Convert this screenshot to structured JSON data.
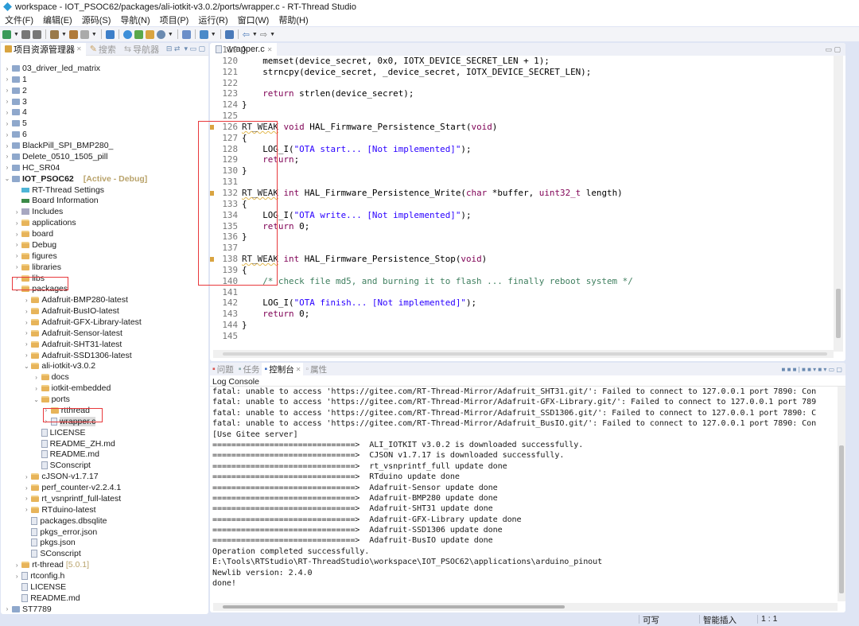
{
  "window": {
    "title": "workspace - IOT_PSOC62/packages/ali-iotkit-v3.0.2/ports/wrapper.c - RT-Thread Studio"
  },
  "menu": [
    "文件(F)",
    "编辑(E)",
    "源码(S)",
    "导航(N)",
    "项目(P)",
    "运行(R)",
    "窗口(W)",
    "帮助(H)"
  ],
  "left_panel": {
    "tabs": [
      "项目资源管理器",
      "搜索",
      "导航器"
    ],
    "tree": [
      {
        "level": 0,
        "arrow": ">",
        "icon": "project",
        "label": "03_driver_led_matrix"
      },
      {
        "level": 0,
        "arrow": ">",
        "icon": "project",
        "label": "1"
      },
      {
        "level": 0,
        "arrow": ">",
        "icon": "project",
        "label": "2"
      },
      {
        "level": 0,
        "arrow": ">",
        "icon": "project",
        "label": "3"
      },
      {
        "level": 0,
        "arrow": ">",
        "icon": "project",
        "label": "4"
      },
      {
        "level": 0,
        "arrow": ">",
        "icon": "project",
        "label": "5"
      },
      {
        "level": 0,
        "arrow": ">",
        "icon": "project",
        "label": "6"
      },
      {
        "level": 0,
        "arrow": ">",
        "icon": "project",
        "label": "BlackPill_SPI_BMP280_"
      },
      {
        "level": 0,
        "arrow": ">",
        "icon": "project",
        "label": "Delete_0510_1505_pill"
      },
      {
        "level": 0,
        "arrow": ">",
        "icon": "project",
        "label": "HC_SR04"
      },
      {
        "level": 0,
        "arrow": "v",
        "icon": "project",
        "label": "IOT_PSOC62",
        "decor": "[Active - Debug]",
        "bold": true
      },
      {
        "level": 1,
        "arrow": "",
        "icon": "rt-settings",
        "label": "RT-Thread Settings"
      },
      {
        "level": 1,
        "arrow": "",
        "icon": "board",
        "label": "Board Information"
      },
      {
        "level": 1,
        "arrow": ">",
        "icon": "includes",
        "label": "Includes"
      },
      {
        "level": 1,
        "arrow": ">",
        "icon": "folder",
        "label": "applications"
      },
      {
        "level": 1,
        "arrow": ">",
        "icon": "folder",
        "label": "board"
      },
      {
        "level": 1,
        "arrow": ">",
        "icon": "folder",
        "label": "Debug"
      },
      {
        "level": 1,
        "arrow": ">",
        "icon": "folder",
        "label": "figures"
      },
      {
        "level": 1,
        "arrow": ">",
        "icon": "folder",
        "label": "libraries"
      },
      {
        "level": 1,
        "arrow": ">",
        "icon": "folder",
        "label": "libs"
      },
      {
        "level": 1,
        "arrow": "v",
        "icon": "folder",
        "label": "packages",
        "highlighted": true
      },
      {
        "level": 2,
        "arrow": ">",
        "icon": "folder",
        "label": "Adafruit-BMP280-latest"
      },
      {
        "level": 2,
        "arrow": ">",
        "icon": "folder",
        "label": "Adafruit-BusIO-latest"
      },
      {
        "level": 2,
        "arrow": ">",
        "icon": "folder",
        "label": "Adafruit-GFX-Library-latest"
      },
      {
        "level": 2,
        "arrow": ">",
        "icon": "folder",
        "label": "Adafruit-Sensor-latest"
      },
      {
        "level": 2,
        "arrow": ">",
        "icon": "folder",
        "label": "Adafruit-SHT31-latest"
      },
      {
        "level": 2,
        "arrow": ">",
        "icon": "folder",
        "label": "Adafruit-SSD1306-latest"
      },
      {
        "level": 2,
        "arrow": "v",
        "icon": "folder",
        "label": "ali-iotkit-v3.0.2"
      },
      {
        "level": 3,
        "arrow": ">",
        "icon": "folder",
        "label": "docs"
      },
      {
        "level": 3,
        "arrow": ">",
        "icon": "folder",
        "label": "iotkit-embedded"
      },
      {
        "level": 3,
        "arrow": "v",
        "icon": "folder",
        "label": "ports"
      },
      {
        "level": 4,
        "arrow": ">",
        "icon": "folder",
        "label": "rtthread"
      },
      {
        "level": 4,
        "arrow": ">",
        "icon": "file",
        "label": "wrapper.c",
        "selected": true,
        "highlighted": true
      },
      {
        "level": 3,
        "arrow": "",
        "icon": "file",
        "label": "LICENSE"
      },
      {
        "level": 3,
        "arrow": "",
        "icon": "file",
        "label": "README_ZH.md"
      },
      {
        "level": 3,
        "arrow": "",
        "icon": "file",
        "label": "README.md"
      },
      {
        "level": 3,
        "arrow": "",
        "icon": "file",
        "label": "SConscript"
      },
      {
        "level": 2,
        "arrow": ">",
        "icon": "folder",
        "label": "cJSON-v1.7.17"
      },
      {
        "level": 2,
        "arrow": ">",
        "icon": "folder",
        "label": "perf_counter-v2.2.4.1"
      },
      {
        "level": 2,
        "arrow": ">",
        "icon": "folder",
        "label": "rt_vsnprintf_full-latest"
      },
      {
        "level": 2,
        "arrow": ">",
        "icon": "folder",
        "label": "RTduino-latest"
      },
      {
        "level": 2,
        "arrow": "",
        "icon": "file",
        "label": "packages.dbsqlite"
      },
      {
        "level": 2,
        "arrow": "",
        "icon": "file",
        "label": "pkgs_error.json"
      },
      {
        "level": 2,
        "arrow": "",
        "icon": "file",
        "label": "pkgs.json"
      },
      {
        "level": 2,
        "arrow": "",
        "icon": "file",
        "label": "SConscript"
      },
      {
        "level": 1,
        "arrow": ">",
        "icon": "folder",
        "label": "rt-thread",
        "decor2": "[5.0.1]"
      },
      {
        "level": 1,
        "arrow": ">",
        "icon": "file",
        "label": "rtconfig.h"
      },
      {
        "level": 1,
        "arrow": "",
        "icon": "file",
        "label": "LICENSE"
      },
      {
        "level": 1,
        "arrow": "",
        "icon": "file",
        "label": "README.md"
      },
      {
        "level": 0,
        "arrow": ">",
        "icon": "project",
        "label": "ST7789"
      }
    ]
  },
  "editor": {
    "tab": "wrapper.c",
    "lines": [
      {
        "n": "119",
        "t": [
          [
            "pl",
            "}"
          ]
        ]
      },
      {
        "n": "120",
        "t": [
          [
            "pl",
            "    memset(device_secret, 0x0, IOTX_DEVICE_SECRET_LEN + 1);"
          ]
        ]
      },
      {
        "n": "121",
        "t": [
          [
            "pl",
            "    strncpy(device_secret, _device_secret, IOTX_DEVICE_SECRET_LEN);"
          ]
        ]
      },
      {
        "n": "122",
        "t": []
      },
      {
        "n": "123",
        "t": [
          [
            "pl",
            "    "
          ],
          [
            "kw",
            "return"
          ],
          [
            "pl",
            " strlen(device_secret);"
          ]
        ]
      },
      {
        "n": "124",
        "t": [
          [
            "pl",
            "}"
          ]
        ]
      },
      {
        "n": "125",
        "t": []
      },
      {
        "n": "126",
        "m": true,
        "t": [
          [
            "warn",
            "RT_WEAK"
          ],
          [
            "pl",
            " "
          ],
          [
            "kw",
            "void"
          ],
          [
            "pl",
            " HAL_Firmware_Persistence_Start("
          ],
          [
            "kw",
            "void"
          ],
          [
            "pl",
            ")"
          ]
        ]
      },
      {
        "n": "127",
        "t": [
          [
            "pl",
            "{"
          ]
        ]
      },
      {
        "n": "128",
        "t": [
          [
            "pl",
            "    LOG_I("
          ],
          [
            "st",
            "\"OTA start... [Not implemented]\""
          ],
          [
            "pl",
            ");"
          ]
        ]
      },
      {
        "n": "129",
        "t": [
          [
            "pl",
            "    "
          ],
          [
            "kw",
            "return"
          ],
          [
            "pl",
            ";"
          ]
        ]
      },
      {
        "n": "130",
        "t": [
          [
            "pl",
            "}"
          ]
        ]
      },
      {
        "n": "131",
        "t": []
      },
      {
        "n": "132",
        "m": true,
        "t": [
          [
            "warn",
            "RT_WEAK"
          ],
          [
            "pl",
            " "
          ],
          [
            "kw",
            "int"
          ],
          [
            "pl",
            " HAL_Firmware_Persistence_Write("
          ],
          [
            "kw",
            "char"
          ],
          [
            "pl",
            " *buffer, "
          ],
          [
            "kw",
            "uint32_t"
          ],
          [
            "pl",
            " length)"
          ]
        ]
      },
      {
        "n": "133",
        "t": [
          [
            "pl",
            "{"
          ]
        ]
      },
      {
        "n": "134",
        "t": [
          [
            "pl",
            "    LOG_I("
          ],
          [
            "st",
            "\"OTA write... [Not implemented]\""
          ],
          [
            "pl",
            ");"
          ]
        ]
      },
      {
        "n": "135",
        "t": [
          [
            "pl",
            "    "
          ],
          [
            "kw",
            "return"
          ],
          [
            "pl",
            " 0;"
          ]
        ]
      },
      {
        "n": "136",
        "t": [
          [
            "pl",
            "}"
          ]
        ]
      },
      {
        "n": "137",
        "t": []
      },
      {
        "n": "138",
        "m": true,
        "t": [
          [
            "warn",
            "RT_WEAK"
          ],
          [
            "pl",
            " "
          ],
          [
            "kw",
            "int"
          ],
          [
            "pl",
            " HAL_Firmware_Persistence_Stop("
          ],
          [
            "kw",
            "void"
          ],
          [
            "pl",
            ")"
          ]
        ]
      },
      {
        "n": "139",
        "t": [
          [
            "pl",
            "{"
          ]
        ]
      },
      {
        "n": "140",
        "t": [
          [
            "pl",
            "    "
          ],
          [
            "cm",
            "/* check file md5, and burning it to flash ... finally reboot system */"
          ]
        ]
      },
      {
        "n": "141",
        "t": []
      },
      {
        "n": "142",
        "t": [
          [
            "pl",
            "    LOG_I("
          ],
          [
            "st",
            "\"OTA finish... [Not implemented]\""
          ],
          [
            "pl",
            ");"
          ]
        ]
      },
      {
        "n": "143",
        "t": [
          [
            "pl",
            "    "
          ],
          [
            "kw",
            "return"
          ],
          [
            "pl",
            " 0;"
          ]
        ]
      },
      {
        "n": "144",
        "t": [
          [
            "pl",
            "}"
          ]
        ]
      },
      {
        "n": "145",
        "t": []
      }
    ]
  },
  "console": {
    "tabs": [
      "问题",
      "任务",
      "控制台",
      "属性"
    ],
    "active_tab": "控制台",
    "title": "Log Console",
    "lines": [
      "fatal: unable to access 'https://gitee.com/RT-Thread-Mirror/Adafruit_SHT31.git/': Failed to connect to 127.0.0.1 port 7890: Con",
      "fatal: unable to access 'https://gitee.com/RT-Thread-Mirror/Adafruit-GFX-Library.git/': Failed to connect to 127.0.0.1 port 789",
      "fatal: unable to access 'https://gitee.com/RT-Thread-Mirror/Adafruit_SSD1306.git/': Failed to connect to 127.0.0.1 port 7890: C",
      "fatal: unable to access 'https://gitee.com/RT-Thread-Mirror/Adafruit_BusIO.git/': Failed to connect to 127.0.0.1 port 7890: Con",
      "[Use Gitee server]",
      "==============================>  ALI_IOTKIT v3.0.2 is downloaded successfully.",
      "==============================>  CJSON v1.7.17 is downloaded successfully.",
      "==============================>  rt_vsnprintf_full update done",
      "==============================>  RTduino update done",
      "==============================>  Adafruit-Sensor update done",
      "==============================>  Adafruit-BMP280 update done",
      "==============================>  Adafruit-SHT31 update done",
      "==============================>  Adafruit-GFX-Library update done",
      "==============================>  Adafruit-SSD1306 update done",
      "==============================>  Adafruit-BusIO update done",
      "Operation completed successfully.",
      "E:\\Tools\\RTStudio\\RT-ThreadStudio\\workspace\\IOT_PSOC62\\applications\\arduino_pinout",
      "Newlib version: 2.4.0",
      "done!"
    ]
  },
  "status": {
    "writable": "可写",
    "insert_mode": "智能插入",
    "position": "1 : 1"
  }
}
